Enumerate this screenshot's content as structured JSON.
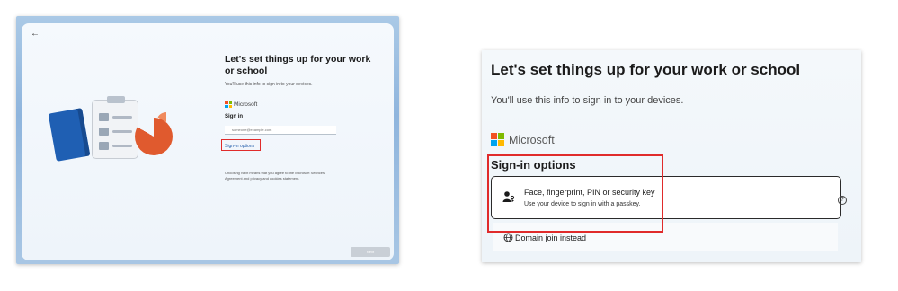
{
  "left_screen": {
    "back_label": "←",
    "title": "Let's set things up for your work or school",
    "subtitle": "You'll use this info to sign in to your devices.",
    "brand": "Microsoft",
    "signin_heading": "Sign in",
    "email_placeholder": "someone@example.com",
    "signin_options_link": "Sign-in options",
    "terms_text": "Choosing Next means that you agree to the Microsoft Services Agreement and privacy and cookies statement.",
    "next_button": "Next"
  },
  "right_screen": {
    "title": "Let's set things up for your work or school",
    "subtitle": "You'll use this info to sign in to your devices.",
    "brand": "Microsoft",
    "options_heading": "Sign-in options",
    "option": {
      "title": "Face, fingerprint, PIN or security key",
      "description": "Use your device to sign in with a passkey.",
      "icon": "person-key-icon"
    },
    "help_label": "?",
    "domain_option": {
      "label": "Domain join instead",
      "icon": "globe-icon"
    }
  },
  "colors": {
    "highlight": "#e02b2b",
    "microsoft_red": "#f25022",
    "microsoft_green": "#7fba00",
    "microsoft_blue": "#00a4ef",
    "microsoft_yellow": "#ffb900",
    "link": "#1b56a8"
  }
}
